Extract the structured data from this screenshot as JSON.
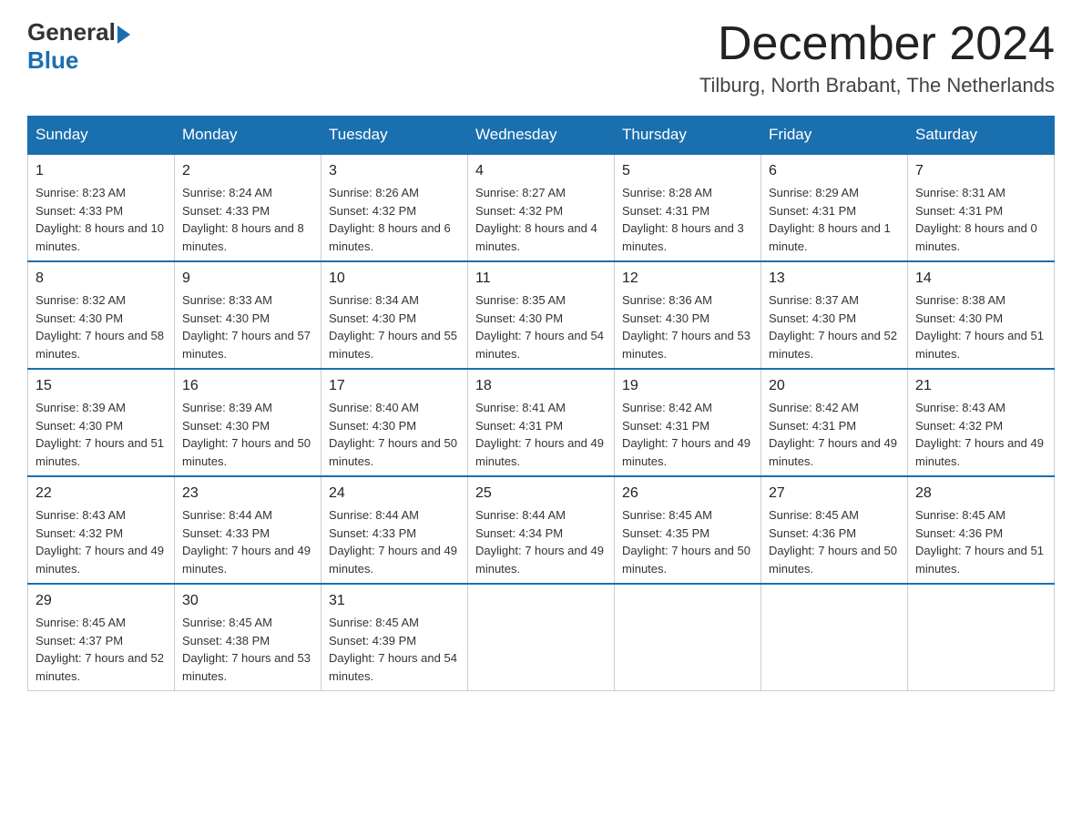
{
  "header": {
    "logo_general": "General",
    "logo_blue": "Blue",
    "title": "December 2024",
    "subtitle": "Tilburg, North Brabant, The Netherlands"
  },
  "calendar": {
    "days_of_week": [
      "Sunday",
      "Monday",
      "Tuesday",
      "Wednesday",
      "Thursday",
      "Friday",
      "Saturday"
    ],
    "weeks": [
      [
        {
          "date": "1",
          "sunrise": "8:23 AM",
          "sunset": "4:33 PM",
          "daylight": "8 hours and 10 minutes."
        },
        {
          "date": "2",
          "sunrise": "8:24 AM",
          "sunset": "4:33 PM",
          "daylight": "8 hours and 8 minutes."
        },
        {
          "date": "3",
          "sunrise": "8:26 AM",
          "sunset": "4:32 PM",
          "daylight": "8 hours and 6 minutes."
        },
        {
          "date": "4",
          "sunrise": "8:27 AM",
          "sunset": "4:32 PM",
          "daylight": "8 hours and 4 minutes."
        },
        {
          "date": "5",
          "sunrise": "8:28 AM",
          "sunset": "4:31 PM",
          "daylight": "8 hours and 3 minutes."
        },
        {
          "date": "6",
          "sunrise": "8:29 AM",
          "sunset": "4:31 PM",
          "daylight": "8 hours and 1 minute."
        },
        {
          "date": "7",
          "sunrise": "8:31 AM",
          "sunset": "4:31 PM",
          "daylight": "8 hours and 0 minutes."
        }
      ],
      [
        {
          "date": "8",
          "sunrise": "8:32 AM",
          "sunset": "4:30 PM",
          "daylight": "7 hours and 58 minutes."
        },
        {
          "date": "9",
          "sunrise": "8:33 AM",
          "sunset": "4:30 PM",
          "daylight": "7 hours and 57 minutes."
        },
        {
          "date": "10",
          "sunrise": "8:34 AM",
          "sunset": "4:30 PM",
          "daylight": "7 hours and 55 minutes."
        },
        {
          "date": "11",
          "sunrise": "8:35 AM",
          "sunset": "4:30 PM",
          "daylight": "7 hours and 54 minutes."
        },
        {
          "date": "12",
          "sunrise": "8:36 AM",
          "sunset": "4:30 PM",
          "daylight": "7 hours and 53 minutes."
        },
        {
          "date": "13",
          "sunrise": "8:37 AM",
          "sunset": "4:30 PM",
          "daylight": "7 hours and 52 minutes."
        },
        {
          "date": "14",
          "sunrise": "8:38 AM",
          "sunset": "4:30 PM",
          "daylight": "7 hours and 51 minutes."
        }
      ],
      [
        {
          "date": "15",
          "sunrise": "8:39 AM",
          "sunset": "4:30 PM",
          "daylight": "7 hours and 51 minutes."
        },
        {
          "date": "16",
          "sunrise": "8:39 AM",
          "sunset": "4:30 PM",
          "daylight": "7 hours and 50 minutes."
        },
        {
          "date": "17",
          "sunrise": "8:40 AM",
          "sunset": "4:30 PM",
          "daylight": "7 hours and 50 minutes."
        },
        {
          "date": "18",
          "sunrise": "8:41 AM",
          "sunset": "4:31 PM",
          "daylight": "7 hours and 49 minutes."
        },
        {
          "date": "19",
          "sunrise": "8:42 AM",
          "sunset": "4:31 PM",
          "daylight": "7 hours and 49 minutes."
        },
        {
          "date": "20",
          "sunrise": "8:42 AM",
          "sunset": "4:31 PM",
          "daylight": "7 hours and 49 minutes."
        },
        {
          "date": "21",
          "sunrise": "8:43 AM",
          "sunset": "4:32 PM",
          "daylight": "7 hours and 49 minutes."
        }
      ],
      [
        {
          "date": "22",
          "sunrise": "8:43 AM",
          "sunset": "4:32 PM",
          "daylight": "7 hours and 49 minutes."
        },
        {
          "date": "23",
          "sunrise": "8:44 AM",
          "sunset": "4:33 PM",
          "daylight": "7 hours and 49 minutes."
        },
        {
          "date": "24",
          "sunrise": "8:44 AM",
          "sunset": "4:33 PM",
          "daylight": "7 hours and 49 minutes."
        },
        {
          "date": "25",
          "sunrise": "8:44 AM",
          "sunset": "4:34 PM",
          "daylight": "7 hours and 49 minutes."
        },
        {
          "date": "26",
          "sunrise": "8:45 AM",
          "sunset": "4:35 PM",
          "daylight": "7 hours and 50 minutes."
        },
        {
          "date": "27",
          "sunrise": "8:45 AM",
          "sunset": "4:36 PM",
          "daylight": "7 hours and 50 minutes."
        },
        {
          "date": "28",
          "sunrise": "8:45 AM",
          "sunset": "4:36 PM",
          "daylight": "7 hours and 51 minutes."
        }
      ],
      [
        {
          "date": "29",
          "sunrise": "8:45 AM",
          "sunset": "4:37 PM",
          "daylight": "7 hours and 52 minutes."
        },
        {
          "date": "30",
          "sunrise": "8:45 AM",
          "sunset": "4:38 PM",
          "daylight": "7 hours and 53 minutes."
        },
        {
          "date": "31",
          "sunrise": "8:45 AM",
          "sunset": "4:39 PM",
          "daylight": "7 hours and 54 minutes."
        },
        null,
        null,
        null,
        null
      ]
    ]
  }
}
